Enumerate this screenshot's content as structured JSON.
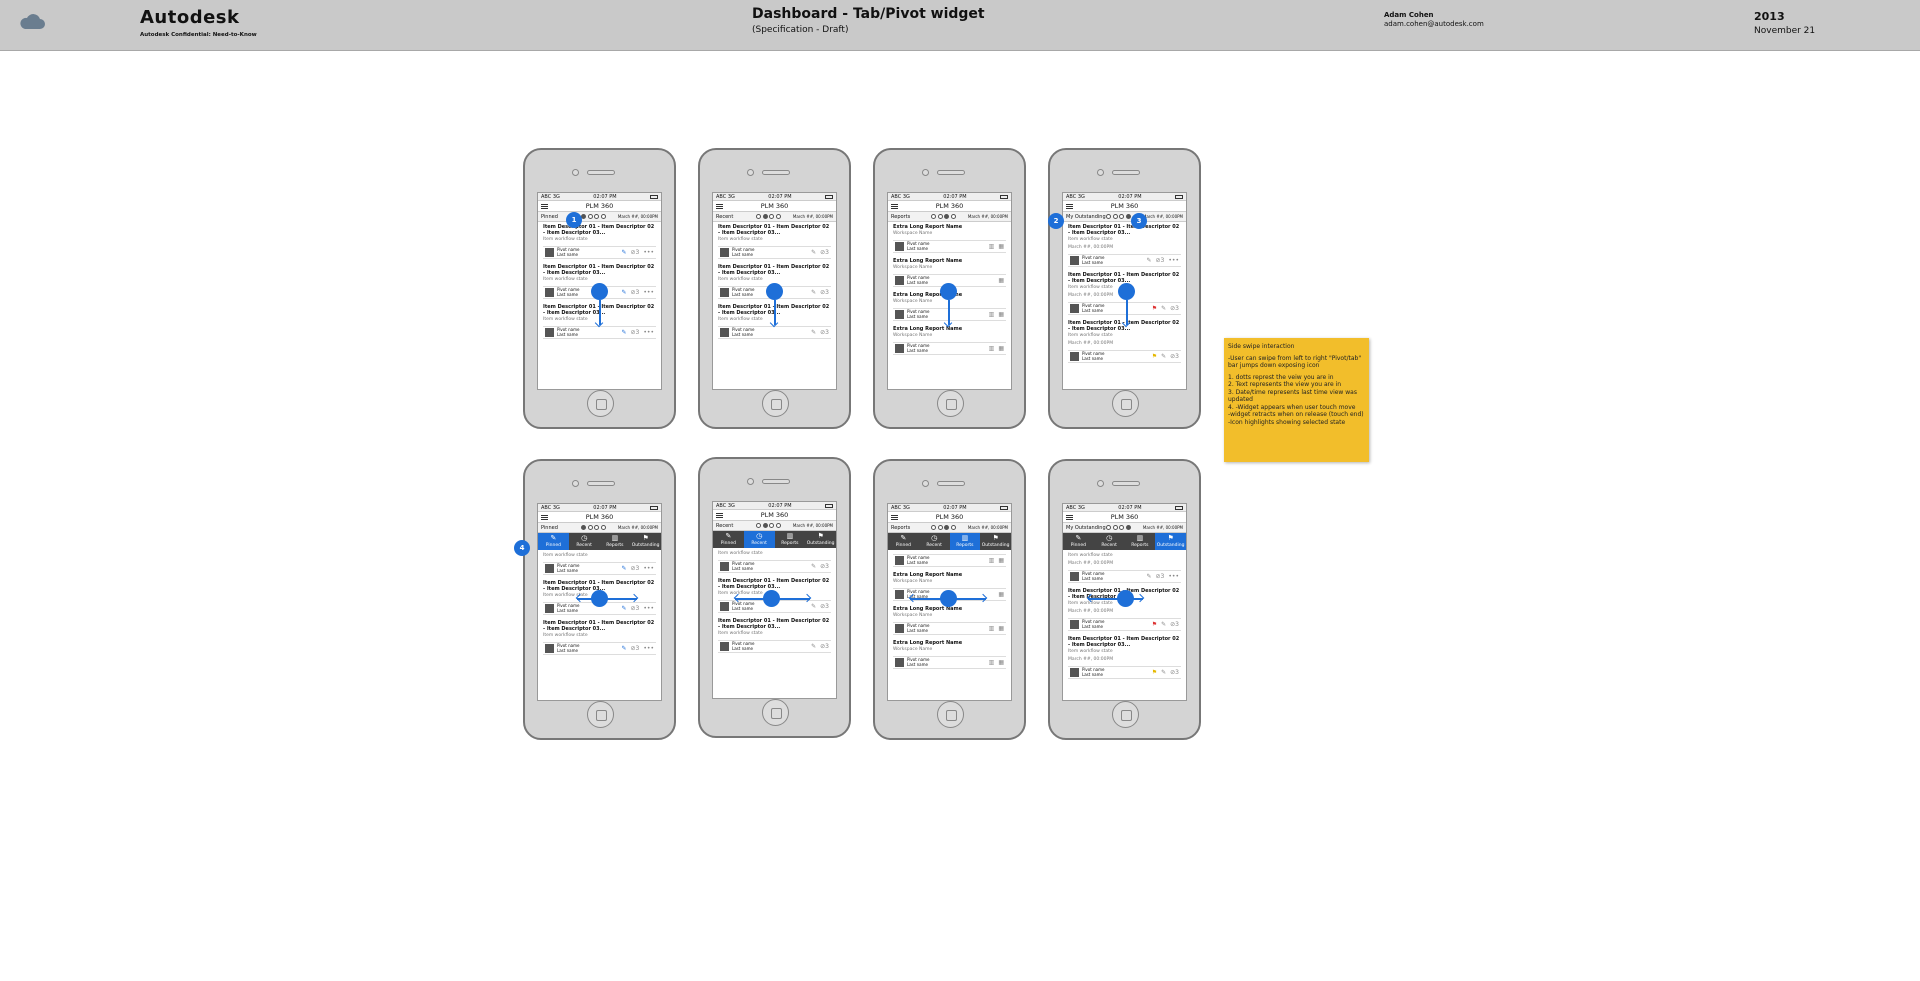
{
  "header": {
    "brand": "Autodesk",
    "brand_sub": "Autodesk Confidential: Need-to-Know",
    "title": "Dashboard - Tab/Pivot widget",
    "subtitle": "(Specification - Draft)",
    "author": "Adam Cohen",
    "email": "adam.cohen@autodesk.com",
    "year": "2013",
    "date": "November 21"
  },
  "common": {
    "carrier": "ABC 3G",
    "time": "02:07 PM",
    "app_title": "PLM 360",
    "date_short": "March ##, 00:00PM",
    "date_updated": "March ##, 00:00PM",
    "item_title": "Item Descriptor 01 - Item Descriptor 02 - Item Descriptor 03...",
    "item_state": "Item workflow state",
    "report_title": "Extra Long Report Name",
    "workspace": "Workspace Name",
    "pivot_name": "Pivot name",
    "last_name": "Last name",
    "attach_count": "3",
    "outstanding_date": "March ##, 00:00PM"
  },
  "tabs": [
    "Pinned",
    "Recent",
    "Reports",
    "Outstanding"
  ],
  "pivot_labels": [
    "Pinned",
    "Recent",
    "Reports",
    "My Outstanding"
  ],
  "badges": [
    "1",
    "2",
    "3",
    "4"
  ],
  "note": {
    "title": "Side swipe interaction",
    "p1": "-User can swipe from left to right \"Pivot/tab\" bar jumps down exposing icon",
    "l1": "1. dotts represt the veiw you are in",
    "l2": "2. Text represents the view you are in",
    "l3": "3. Date/time represents last time view was updated",
    "l4": "4. -Widget appears when user touch move",
    "l5": "-widget retracts when on release (touch end)",
    "l6": "-Icon highlights showing selected state"
  },
  "colors": {
    "accent": "#1e6fd8",
    "note": "#f2be2b",
    "header": "#c9c9c9"
  }
}
